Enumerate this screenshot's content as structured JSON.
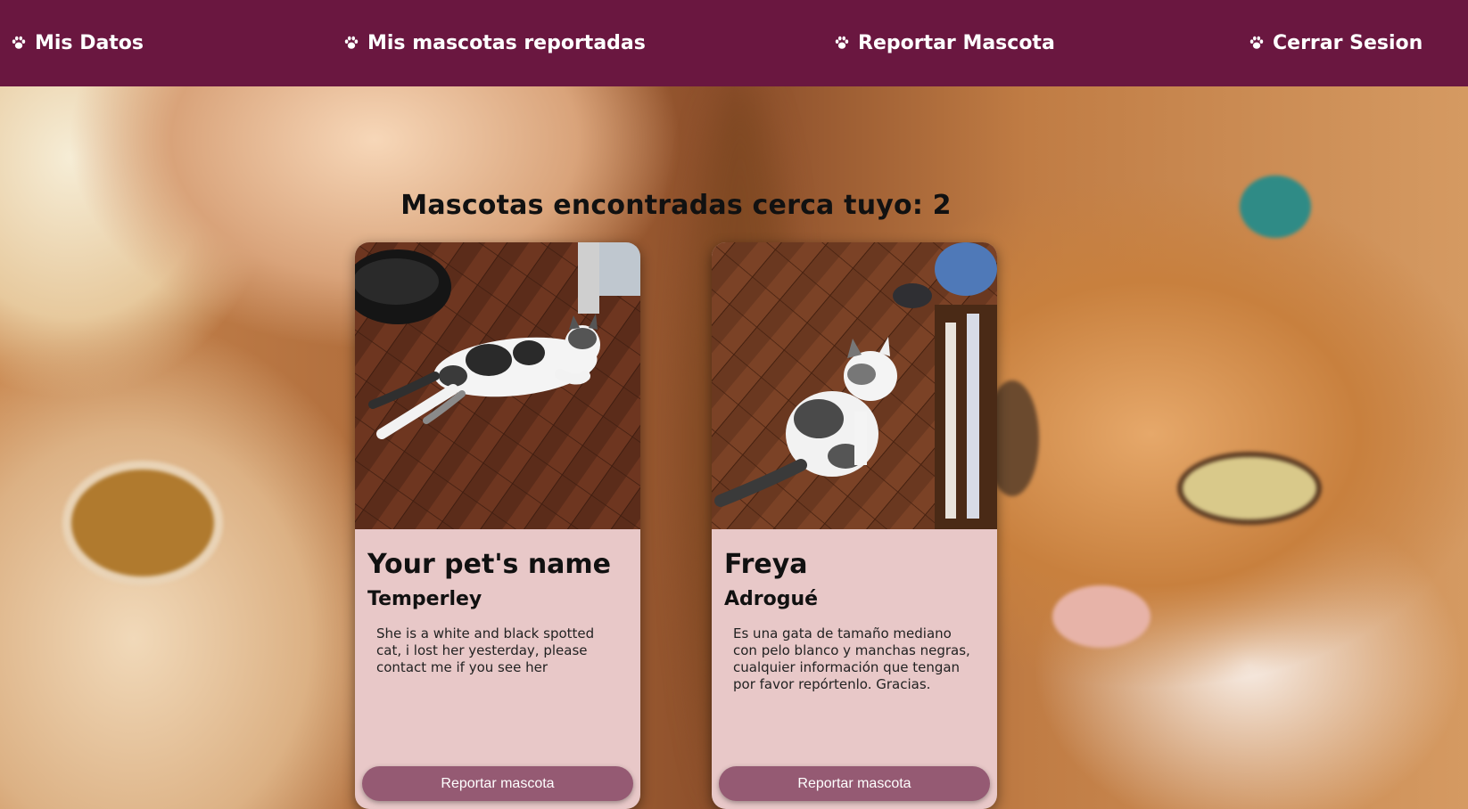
{
  "nav": {
    "items": [
      {
        "label": "Mis Datos",
        "icon": "paw-icon"
      },
      {
        "label": "Mis mascotas reportadas",
        "icon": "paw-icon"
      },
      {
        "label": "Reportar Mascota",
        "icon": "paw-icon"
      },
      {
        "label": "Cerrar Sesion",
        "icon": "paw-icon"
      }
    ]
  },
  "page": {
    "title": "Mascotas encontradas cerca tuyo: 2"
  },
  "pets": [
    {
      "name": "Your pet's name",
      "location": "Temperley",
      "description": "She is a white and black spotted cat, i lost her yesterday, please contact me if you see her",
      "button_label": "Reportar mascota"
    },
    {
      "name": "Freya",
      "location": "Adrogué",
      "description": "Es una gata de tamaño mediano con pelo blanco y manchas negras, cualquier información que tengan por favor repórtenlo. Gracias.",
      "button_label": "Reportar mascota"
    }
  ],
  "colors": {
    "navbar": "#6a1740",
    "card": "#e8c8c8",
    "button": "#955a73",
    "nav_text": "#ffffff"
  }
}
